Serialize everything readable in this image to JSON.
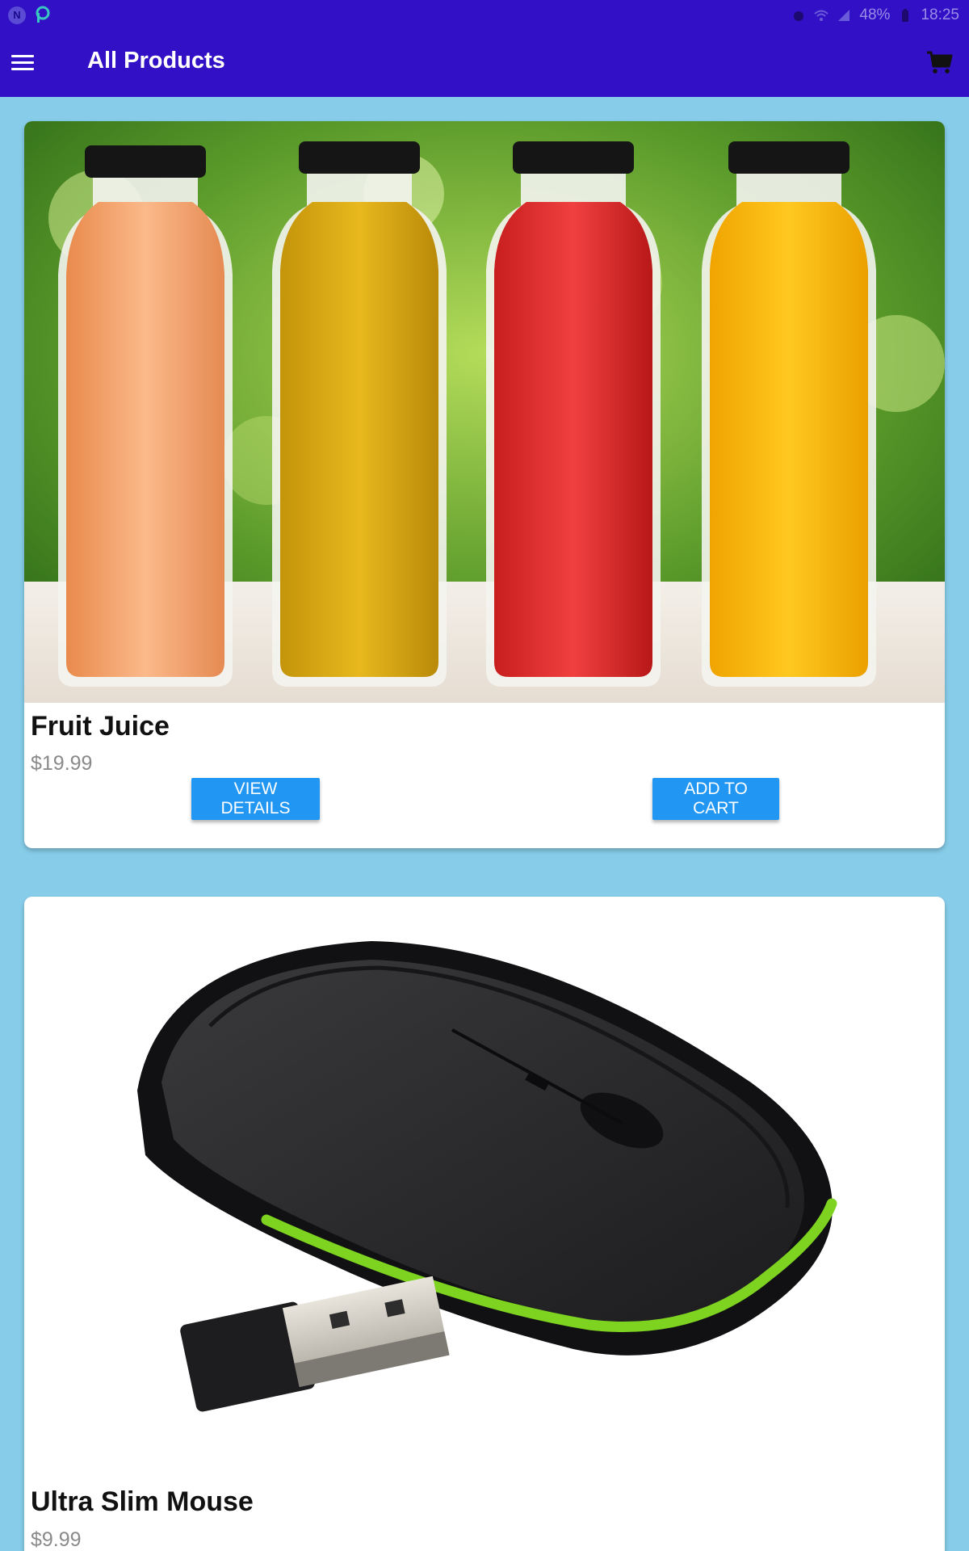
{
  "status_bar": {
    "battery": "48%",
    "time": "18:25"
  },
  "app_bar": {
    "title": "All Products",
    "menu_icon": "hamburger-menu-icon",
    "cart_icon": "shopping-cart-icon"
  },
  "products": [
    {
      "name": "Fruit Juice",
      "price": "$19.99",
      "view_label": "VIEW DETAILS",
      "cart_label": "ADD TO CART"
    },
    {
      "name": "Ultra Slim Mouse",
      "price": "$9.99"
    }
  ],
  "colors": {
    "app_bar": "#3210c6",
    "background": "#87cdea",
    "button": "#2196f3"
  }
}
